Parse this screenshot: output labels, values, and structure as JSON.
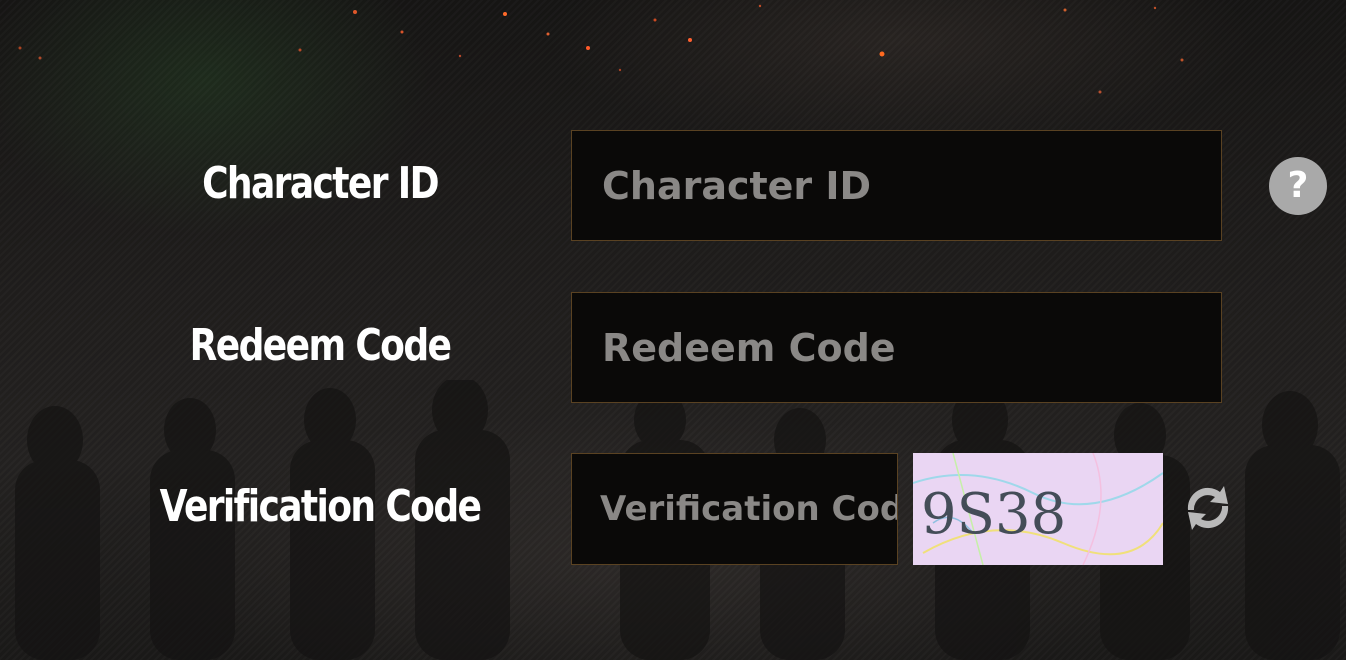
{
  "form": {
    "character_id": {
      "label": "Character ID",
      "placeholder": "Character ID",
      "value": ""
    },
    "redeem_code": {
      "label": "Redeem Code",
      "placeholder": "Redeem Code",
      "value": ""
    },
    "verification_code": {
      "label": "Verification Code",
      "placeholder": "Verification Code",
      "value": ""
    },
    "captcha": {
      "text": "9S38"
    }
  },
  "icons": {
    "help": "question-mark-icon",
    "refresh": "refresh-arrows-icon"
  },
  "colors": {
    "label_text": "#ffffff",
    "input_background": "#0a0908",
    "input_border": "#5a4222",
    "placeholder_text": "#8a8886",
    "help_icon_bg": "#a9a9a9",
    "captcha_background": "#ead6f3",
    "refresh_icon": "#b9b9b9"
  }
}
